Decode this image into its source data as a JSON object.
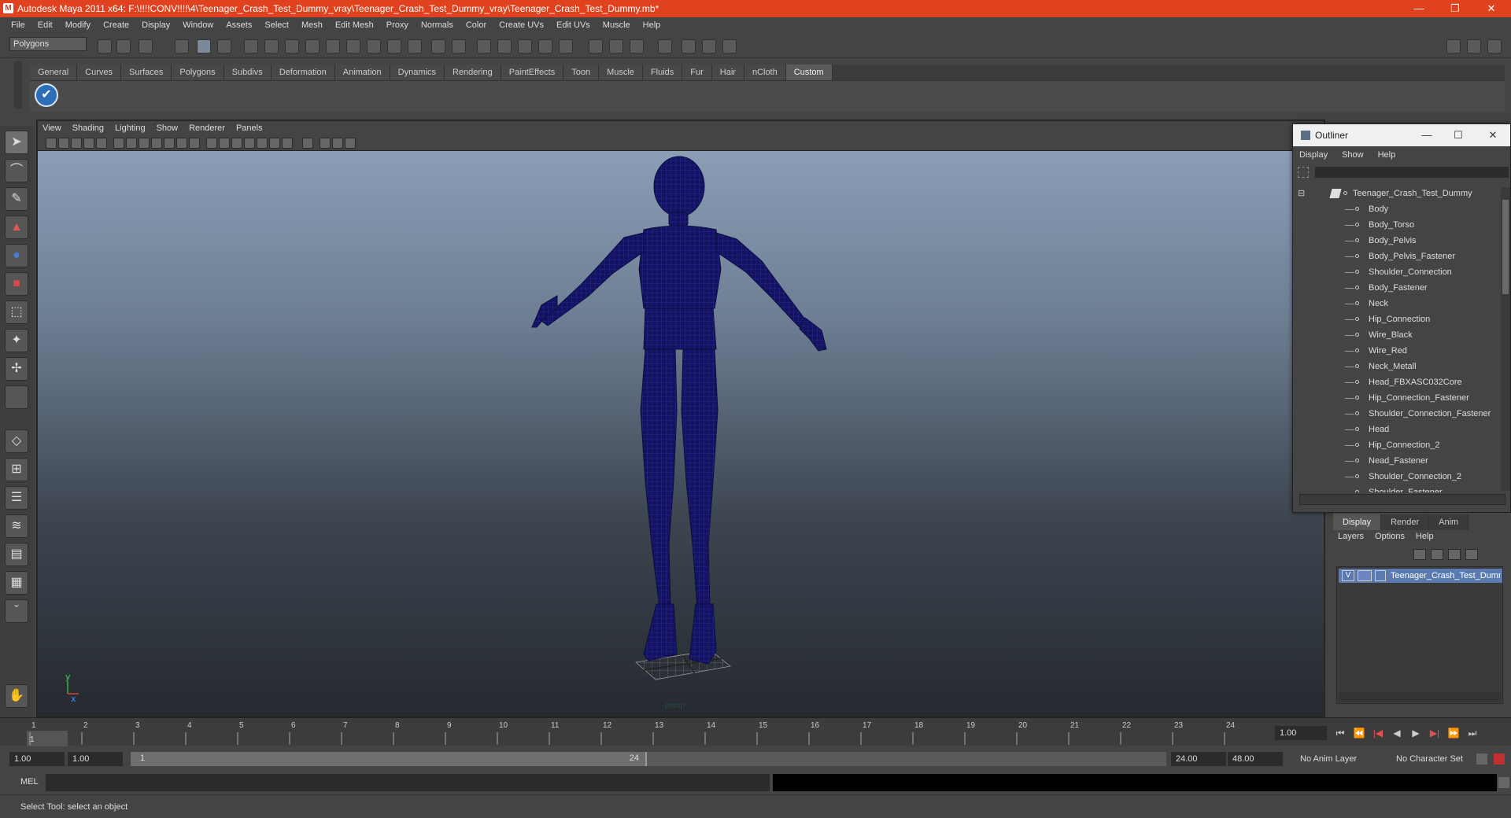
{
  "window": {
    "title": "Autodesk Maya 2011 x64: F:\\!!!!CONV!!!!\\4\\Teenager_Crash_Test_Dummy_vray\\Teenager_Crash_Test_Dummy_vray\\Teenager_Crash_Test_Dummy.mb*",
    "logo_letter": "M",
    "minimize": "—",
    "restore": "❐",
    "close": "✕"
  },
  "menubar": [
    "File",
    "Edit",
    "Modify",
    "Create",
    "Display",
    "Window",
    "Assets",
    "Select",
    "Mesh",
    "Edit Mesh",
    "Proxy",
    "Normals",
    "Color",
    "Create UVs",
    "Edit UVs",
    "Muscle",
    "Help"
  ],
  "mode_selector": {
    "value": "Polygons"
  },
  "shelf": {
    "tabs": [
      "General",
      "Curves",
      "Surfaces",
      "Polygons",
      "Subdivs",
      "Deformation",
      "Animation",
      "Dynamics",
      "Rendering",
      "PaintEffects",
      "Toon",
      "Muscle",
      "Fluids",
      "Fur",
      "Hair",
      "nCloth",
      "Custom"
    ],
    "active_tab": "Custom",
    "button_glyph": "✔"
  },
  "viewport": {
    "menu": [
      "View",
      "Shading",
      "Lighting",
      "Show",
      "Renderer",
      "Panels"
    ],
    "camera_label": "persp",
    "axis_y": "y",
    "axis_x": "x",
    "wireframe_color": "#14145e",
    "background_top": "#8b9eb6",
    "background_bottom": "#262a30"
  },
  "outliner": {
    "title": "Outliner",
    "minimize": "—",
    "maximize": "☐",
    "close": "✕",
    "menu": [
      "Display",
      "Show",
      "Help"
    ],
    "collapse_glyph": "⊟",
    "root": "Teenager_Crash_Test_Dummy",
    "items": [
      "Body",
      "Body_Torso",
      "Body_Pelvis",
      "Body_Pelvis_Fastener",
      "Shoulder_Connection",
      "Body_Fastener",
      "Neck",
      "Hip_Connection",
      "Wire_Black",
      "Wire_Red",
      "Neck_Metall",
      "Head_FBXASC032Core",
      "Hip_Connection_Fastener",
      "Shoulder_Connection_Fastener",
      "Head",
      "Hip_Connection_2",
      "Nead_Fastener",
      "Shoulder_Connection_2",
      "Shoulder_Fastener"
    ]
  },
  "layers": {
    "tabs": [
      "Display",
      "Render",
      "Anim"
    ],
    "active_tab": "Display",
    "menu": [
      "Layers",
      "Options",
      "Help"
    ],
    "layer_visible": "V",
    "layer_name": "Teenager_Crash_Test_Dummy"
  },
  "timeline": {
    "frames": [
      "1",
      "2",
      "3",
      "4",
      "5",
      "6",
      "7",
      "8",
      "9",
      "10",
      "11",
      "12",
      "13",
      "14",
      "15",
      "16",
      "17",
      "18",
      "19",
      "20",
      "21",
      "22",
      "23",
      "24"
    ],
    "current_frame_marker": "1",
    "current_frame": "1.00",
    "playback_glyphs": [
      "⏮",
      "⏪",
      "|◀",
      "◀",
      "▶",
      "▶|",
      "⏩",
      "⏭"
    ]
  },
  "range": {
    "start": "1.00",
    "playback_start": "1.00",
    "slider_start": "1",
    "slider_end": "24",
    "playback_end": "24.00",
    "end": "48.00",
    "anim_layer": "No Anim Layer",
    "character_set": "No Character Set"
  },
  "command_line": {
    "label": "MEL"
  },
  "status": {
    "help_text": "Select Tool: select an object"
  }
}
